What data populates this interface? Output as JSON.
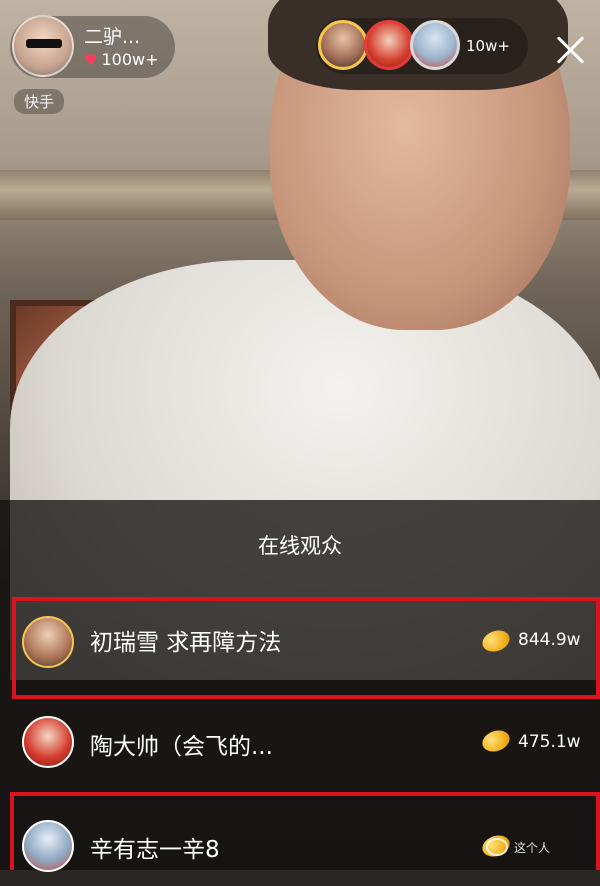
{
  "host": {
    "name": "二驴...",
    "likes": "100w+",
    "platform": "快手"
  },
  "viewers": {
    "count": "10w+"
  },
  "panel": {
    "title": "在线观众",
    "rows": [
      {
        "name": "初瑞雪 求再障方法",
        "amount": "844.9w",
        "highlighted": true
      },
      {
        "name": "陶大帅（会飞的...",
        "amount": "475.1w",
        "highlighted": false
      },
      {
        "name": "辛有志一辛8",
        "amount": "",
        "highlighted": true
      }
    ]
  },
  "watermark": "这个人",
  "colors": {
    "highlight": "#d8141c",
    "coin": "#f2b21e",
    "heart": "#ff3b5c"
  }
}
